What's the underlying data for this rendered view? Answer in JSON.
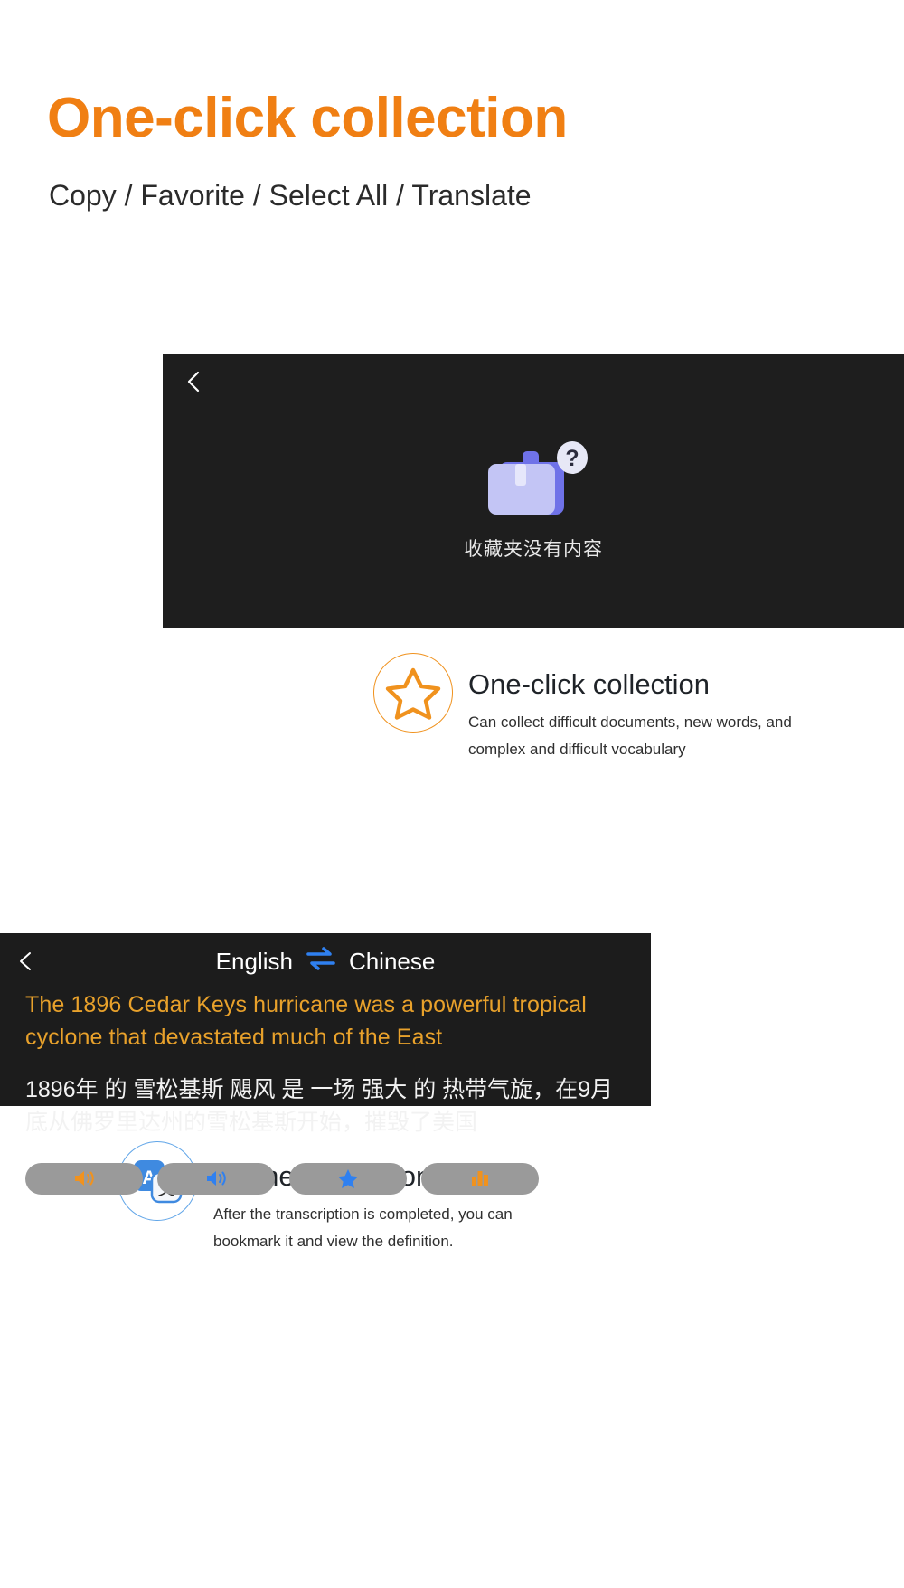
{
  "hero": {
    "title": "One-click collection",
    "subtitle": "Copy / Favorite / Select All / Translate",
    "title_color": "#f07f13"
  },
  "favorites_panel": {
    "back_icon": "chevron-left-icon",
    "empty_icon": "briefcase-question-icon",
    "empty_caption": "收藏夹没有内容",
    "background_color": "#1e1e1e"
  },
  "feature_collection": {
    "icon": "star-outline-icon",
    "icon_color": "#f0921e",
    "title": "One-click collection",
    "description": "Can collect difficult documents, new words, and complex and difficult vocabulary"
  },
  "translation_panel": {
    "back_icon": "chevron-left-icon",
    "source_language": "English",
    "swap_icon": "swap-arrows-icon",
    "swap_icon_color": "#2f80f0",
    "target_language": "Chinese",
    "source_text": "The 1896 Cedar Keys hurricane was a powerful tropical cyclone that devastated much of the East",
    "source_text_color": "#e8a12b",
    "target_text": "1896年 的 雪松基斯 飓风 是 一场 强大 的 热带气旋，在9月底从佛罗里达州的雪松基斯开始，摧毁了美国",
    "background_color": "#1c1c1c",
    "buttons": [
      {
        "name": "speak-source-button",
        "icon": "speaker-icon",
        "icon_color": "#f0921e"
      },
      {
        "name": "speak-target-button",
        "icon": "speaker-icon",
        "icon_color": "#2f80f0"
      },
      {
        "name": "favorite-button",
        "icon": "star-filled-icon",
        "icon_color": "#2f80f0"
      },
      {
        "name": "statistics-button",
        "icon": "bar-chart-icon",
        "icon_color": "#f0921e"
      }
    ]
  },
  "feature_translation": {
    "icon": "translate-icon",
    "icon_color": "#60a5e8",
    "title": "Online translation",
    "description": "After the transcription is completed, you can bookmark it and view the definition."
  }
}
